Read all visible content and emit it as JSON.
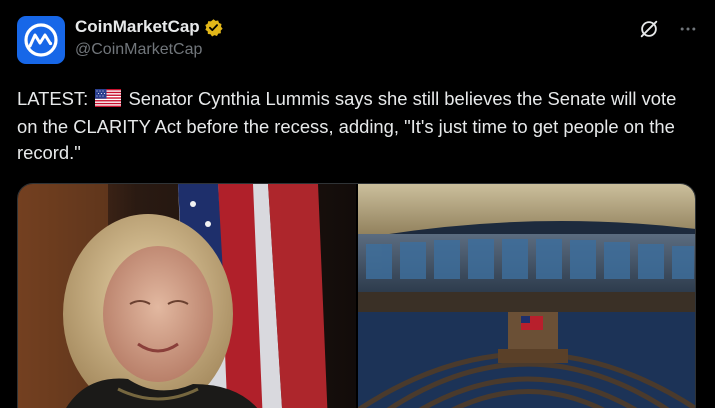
{
  "account": {
    "display_name": "CoinMarketCap",
    "handle": "@CoinMarketCap",
    "verified_icon": "verified-badge-icon",
    "avatar_icon": "coinmarketcap-logo-icon"
  },
  "actions": {
    "grok_icon": "grok-icon",
    "more_icon": "more-options-icon"
  },
  "tweet": {
    "prefix": "LATEST:",
    "flag_icon": "us-flag-icon",
    "body": "Senator Cynthia Lummis says she still believes the Senate will vote on the CLARITY Act before the recess, adding, \"It's just time to get people on the record.\""
  },
  "media": {
    "left_image": "senator-portrait-photo",
    "right_image": "house-chamber-photo"
  },
  "colors": {
    "background": "#000000",
    "text": "#e7e9ea",
    "secondary_text": "#71767b",
    "avatar_blue": "#1767e8",
    "verified_gold": "#e2b719"
  }
}
